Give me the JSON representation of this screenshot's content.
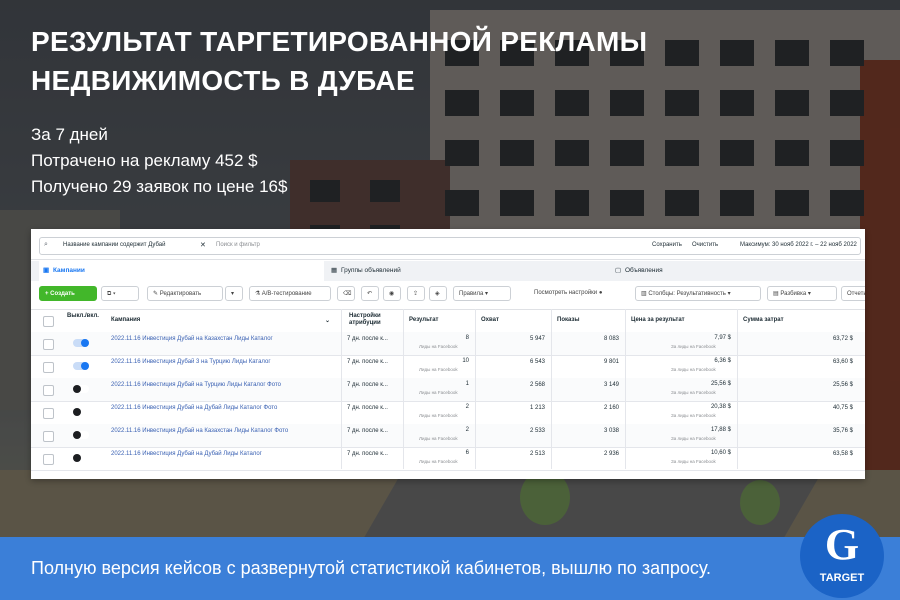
{
  "headline": {
    "line1": "РЕЗУЛЬТАТ ТАРГЕТИРОВАННОЙ РЕКЛАМЫ",
    "line2": "НЕДВИЖИМОСТЬ В ДУБАЕ"
  },
  "stats": {
    "period": "За 7 дней",
    "spent": "Потрачено на рекламу 452 $",
    "leads": "Получено 29 заявок по цене 16$"
  },
  "ads_manager": {
    "filter_chip": "Название кампании содержит Дубай",
    "search_placeholder": "Поиск и фильтр",
    "save_label": "Сохранить",
    "clear_label": "Очистить",
    "date_range": "Максимум: 30 нояб 2022 г. – 22 нояб 2022",
    "tabs": [
      "Кампании",
      "Группы объявлений",
      "Объявления"
    ],
    "toolbar": {
      "create": "+ Создать",
      "edit": "Редактировать",
      "ab_test": "A/B-тестирование",
      "rules": "Правила",
      "view_settings": "Посмотреть настройки",
      "columns": "Столбцы: Результативность",
      "breakdown": "Разбивка",
      "reports": "Отчеты"
    },
    "columns": [
      "Выкл./вкл.",
      "Кампания",
      "Настройки атрибуции",
      "Результат",
      "Охват",
      "Показы",
      "Цена за результат",
      "Сумма затрат"
    ],
    "rows": [
      {
        "on": true,
        "campaign": "2022.11.16 Инвестиция Дубай на Казахстан Лиды Каталог",
        "attribution": "7 дн. после к...",
        "result": "8",
        "result_sub": "Лиды на Facebook",
        "reach": "5 947",
        "impressions": "8 083",
        "cpr": "7,97 $",
        "cpr_sub": "За лиды на Facebook",
        "spend": "63,72 $"
      },
      {
        "on": true,
        "campaign": "2022.11.16 Инвестиция Дубай 3 на Турцию Лиды Каталог",
        "attribution": "7 дн. после к...",
        "result": "10",
        "result_sub": "Лиды на Facebook",
        "reach": "6 543",
        "impressions": "9 801",
        "cpr": "6,36 $",
        "cpr_sub": "За лиды на Facebook",
        "spend": "63,60 $"
      },
      {
        "on": false,
        "campaign": "2022.11.16 Инвестиция Дубай на Турцию Лиды Каталог Фото",
        "attribution": "7 дн. после к...",
        "result": "1",
        "result_sub": "Лиды на Facebook",
        "reach": "2 568",
        "impressions": "3 149",
        "cpr": "25,56 $",
        "cpr_sub": "За лиды на Facebook",
        "spend": "25,56 $"
      },
      {
        "on": false,
        "campaign": "2022.11.16 Инвестиция Дубай на Дубай Лиды Каталог Фото",
        "attribution": "7 дн. после к...",
        "result": "2",
        "result_sub": "Лиды на Facebook",
        "reach": "1 213",
        "impressions": "2 160",
        "cpr": "20,38 $",
        "cpr_sub": "За лиды на Facebook",
        "spend": "40,75 $"
      },
      {
        "on": false,
        "campaign": "2022.11.16 Инвестиция Дубай на Казахстан Лиды Каталог Фото",
        "attribution": "7 дн. после к...",
        "result": "2",
        "result_sub": "Лиды на Facebook",
        "reach": "2 533",
        "impressions": "3 038",
        "cpr": "17,88 $",
        "cpr_sub": "За лиды на Facebook",
        "spend": "35,76 $"
      },
      {
        "on": false,
        "campaign": "2022.11.16 Инвестиция Дубай на Дубай Лиды Каталог",
        "attribution": "7 дн. после к...",
        "result": "6",
        "result_sub": "Лиды на Facebook",
        "reach": "2 513",
        "impressions": "2 936",
        "cpr": "10,60 $",
        "cpr_sub": "За лиды на Facebook",
        "spend": "63,58 $"
      }
    ]
  },
  "banner": {
    "text": "Полную версия кейсов с развернутой статистикой кабинетов, вышлю по запросу."
  },
  "logo": {
    "letter": "G",
    "caption": "TARGET"
  },
  "colors": {
    "banner": "#3b7fd8",
    "logo": "#1b63c6",
    "create_button": "#42b72a",
    "toggle_on": "#1877f2"
  }
}
